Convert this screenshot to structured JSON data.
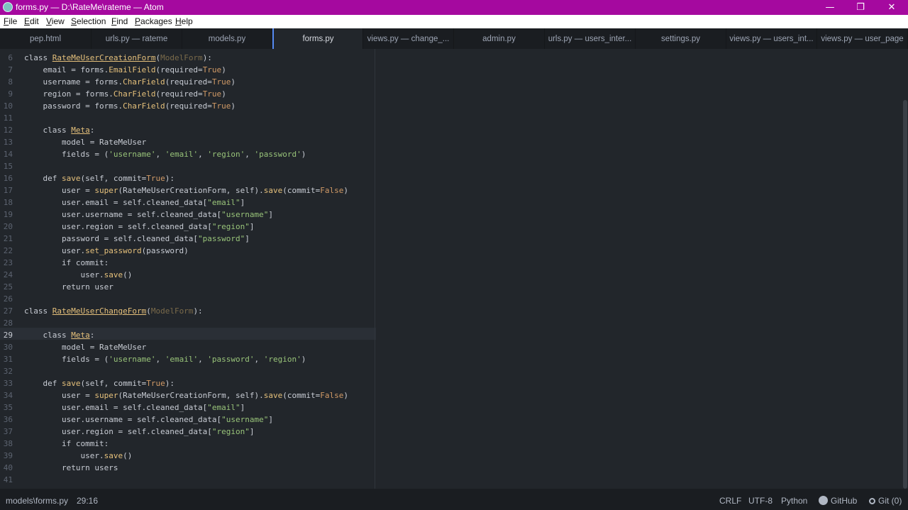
{
  "window": {
    "title": "forms.py — D:\\RateMe\\rateme — Atom",
    "minimize": "—",
    "restore": "❐",
    "close": "✕"
  },
  "menu": [
    {
      "u": "F",
      "rest": "ile"
    },
    {
      "u": "E",
      "rest": "dit"
    },
    {
      "u": "V",
      "rest": "iew"
    },
    {
      "u": "S",
      "rest": "election"
    },
    {
      "u": "F",
      "rest": "ind"
    },
    {
      "u": "P",
      "rest": "ackages"
    },
    {
      "u": "H",
      "rest": "elp"
    }
  ],
  "tabs": [
    "pep.html",
    "urls.py — rateme",
    "models.py",
    "forms.py",
    "views.py — change_...",
    "admin.py",
    "urls.py — users_inter...",
    "settings.py",
    "views.py — users_int...",
    "views.py — user_page"
  ],
  "active_tab": "forms.py",
  "editor": {
    "current_line": "29",
    "line_numbers": [
      "6",
      "7",
      "8",
      "9",
      "10",
      "11",
      "12",
      "13",
      "14",
      "15",
      "16",
      "17",
      "18",
      "19",
      "20",
      "21",
      "22",
      "23",
      "24",
      "25",
      "26",
      "27",
      "28",
      "29",
      "30",
      "31",
      "32",
      "33",
      "34",
      "35",
      "36",
      "37",
      "38",
      "39",
      "40",
      "41"
    ]
  },
  "code": {
    "l6": [
      "class ",
      "RateMeUserCreationForm",
      "(",
      "ModelForm",
      "):"
    ],
    "l7": [
      "    email = forms.",
      "EmailField",
      "(required=",
      "True",
      ")"
    ],
    "l8": [
      "    username = forms.",
      "CharField",
      "(required=",
      "True",
      ")"
    ],
    "l9": [
      "    region = forms.",
      "CharField",
      "(required=",
      "True",
      ")"
    ],
    "l10": [
      "    password = forms.",
      "CharField",
      "(required=",
      "True",
      ")"
    ],
    "l12": [
      "    class ",
      "Meta",
      ":"
    ],
    "l13": [
      "        model = RateMeUser"
    ],
    "l14": [
      "        fields = (",
      "'username'",
      ", ",
      "'email'",
      ", ",
      "'region'",
      ", ",
      "'password'",
      ")"
    ],
    "l16": [
      "    def ",
      "save",
      "(self, commit=",
      "True",
      "):"
    ],
    "l17": [
      "        user = ",
      "super",
      "(RateMeUserCreationForm, self).",
      "save",
      "(commit=",
      "False",
      ")"
    ],
    "l18": [
      "        user.email = self.cleaned_data[",
      "\"email\"",
      "]"
    ],
    "l19": [
      "        user.username = self.cleaned_data[",
      "\"username\"",
      "]"
    ],
    "l20": [
      "        user.region = self.cleaned_data[",
      "\"region\"",
      "]"
    ],
    "l21": [
      "        password = self.cleaned_data[",
      "\"password\"",
      "]"
    ],
    "l22": [
      "        user.",
      "set_password",
      "(password)"
    ],
    "l23": [
      "        if commit:"
    ],
    "l24": [
      "            user.",
      "save",
      "()"
    ],
    "l25": [
      "        return user"
    ],
    "l27": [
      "class ",
      "RateMeUserChangeForm",
      "(",
      "ModelForm",
      "):"
    ],
    "l29": [
      "    class ",
      "Meta",
      ":"
    ],
    "l30": [
      "        model = RateMeUser"
    ],
    "l31": [
      "        fields = (",
      "'username'",
      ", ",
      "'email'",
      ", ",
      "'password'",
      ", ",
      "'region'",
      ")"
    ],
    "l33": [
      "    def ",
      "save",
      "(self, commit=",
      "True",
      "):"
    ],
    "l34": [
      "        user = ",
      "super",
      "(RateMeUserCreationForm, self).",
      "save",
      "(commit=",
      "False",
      ")"
    ],
    "l35": [
      "        user.email = self.cleaned_data[",
      "\"email\"",
      "]"
    ],
    "l36": [
      "        user.username = self.cleaned_data[",
      "\"username\"",
      "]"
    ],
    "l37": [
      "        user.region = self.cleaned_data[",
      "\"region\"",
      "]"
    ],
    "l38": [
      "        if commit:"
    ],
    "l39": [
      "            user.",
      "save",
      "()"
    ],
    "l40": [
      "        return users"
    ]
  },
  "status": {
    "path": "models\\forms.py",
    "cursor": "29:16",
    "line_ending": "CRLF",
    "encoding": "UTF-8",
    "grammar": "Python",
    "github": "GitHub",
    "git": "Git (0)"
  },
  "colors": {
    "titlebar": "#a5099f",
    "accent": "#568af2",
    "string": "#98c379",
    "class": "#e5c07b",
    "builtin": "#d19a66"
  }
}
